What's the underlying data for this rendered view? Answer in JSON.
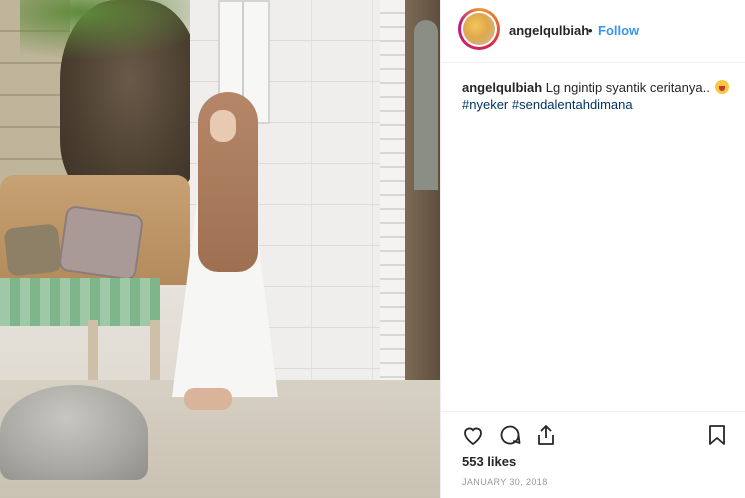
{
  "header": {
    "username": "angelqulbiah",
    "separator": "•",
    "follow_label": "Follow"
  },
  "caption": {
    "username": "angelqulbiah",
    "text": "Lg ngintip syantik ceritanya..",
    "hashtags": [
      "#nyeker",
      "#sendalentahdimana"
    ]
  },
  "actions": {
    "like_icon": "heart-icon",
    "comment_icon": "comment-bubble-icon",
    "share_icon": "share-icon",
    "save_icon": "bookmark-icon"
  },
  "likes_text": "553 likes",
  "date_text": "JANUARY 30, 2018",
  "colors": {
    "accent": "#3897f0",
    "hashtag": "#003569",
    "text": "#262626",
    "muted": "#999999",
    "divider": "#efefef"
  }
}
